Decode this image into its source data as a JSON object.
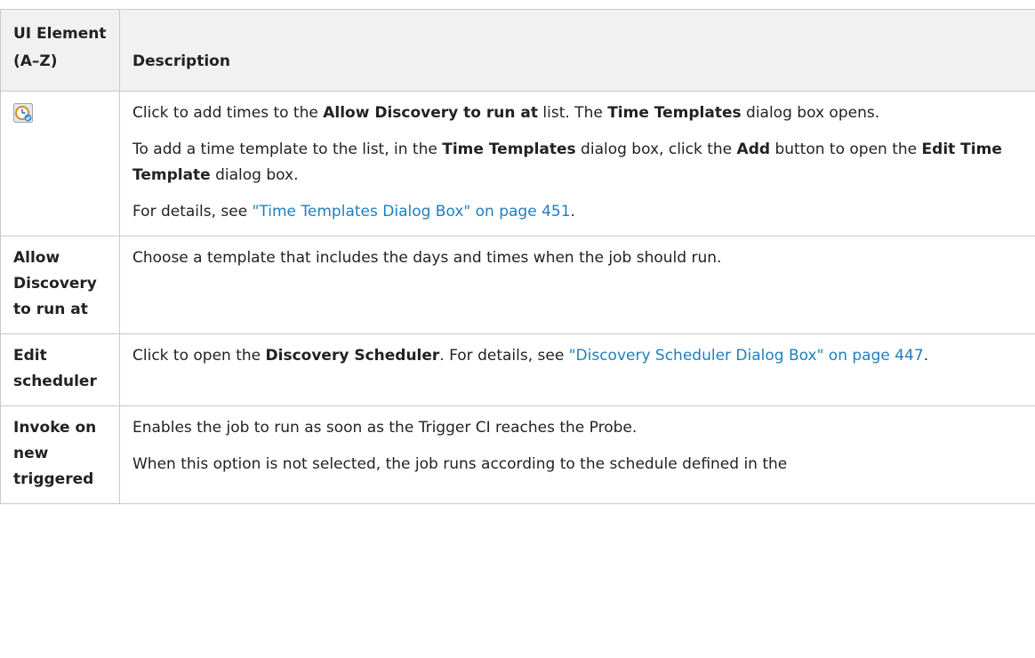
{
  "table": {
    "header": {
      "col1": "UI Element (A–Z)",
      "col2": "Description"
    },
    "rows": [
      {
        "icon": "time-template-add-icon",
        "p1": {
          "t1": "Click to add times to the ",
          "b1": "Allow Discovery to run at",
          "t2": " list. The ",
          "b2": "Time Templates",
          "t3": " dialog box opens."
        },
        "p2": {
          "t1": "To add a time template to the list, in the ",
          "b1": "Time Templates",
          "t2": " dialog box, click the ",
          "b2": "Add",
          "t3": " button to open the ",
          "b3": "Edit Time Template",
          "t4": " dialog box."
        },
        "p3": {
          "t1": "For details, see ",
          "link": "\"Time Templates Dialog Box\" on page 451",
          "t2": "."
        }
      },
      {
        "label": "Allow Discovery to run at",
        "p1": "Choose a template that includes the days and times when the job should run."
      },
      {
        "label": "Edit scheduler",
        "p1": {
          "t1": "Click to open the ",
          "b1": "Discovery Scheduler",
          "t2": ". For details, see ",
          "link": "\"Discovery Scheduler Dialog Box\" on page 447",
          "t3": "."
        }
      },
      {
        "label": "Invoke on new triggered",
        "p1": "Enables the job to run as soon as the Trigger CI reaches the Probe.",
        "p2": "When this option is not selected, the job runs according to the schedule defined in the"
      }
    ]
  }
}
